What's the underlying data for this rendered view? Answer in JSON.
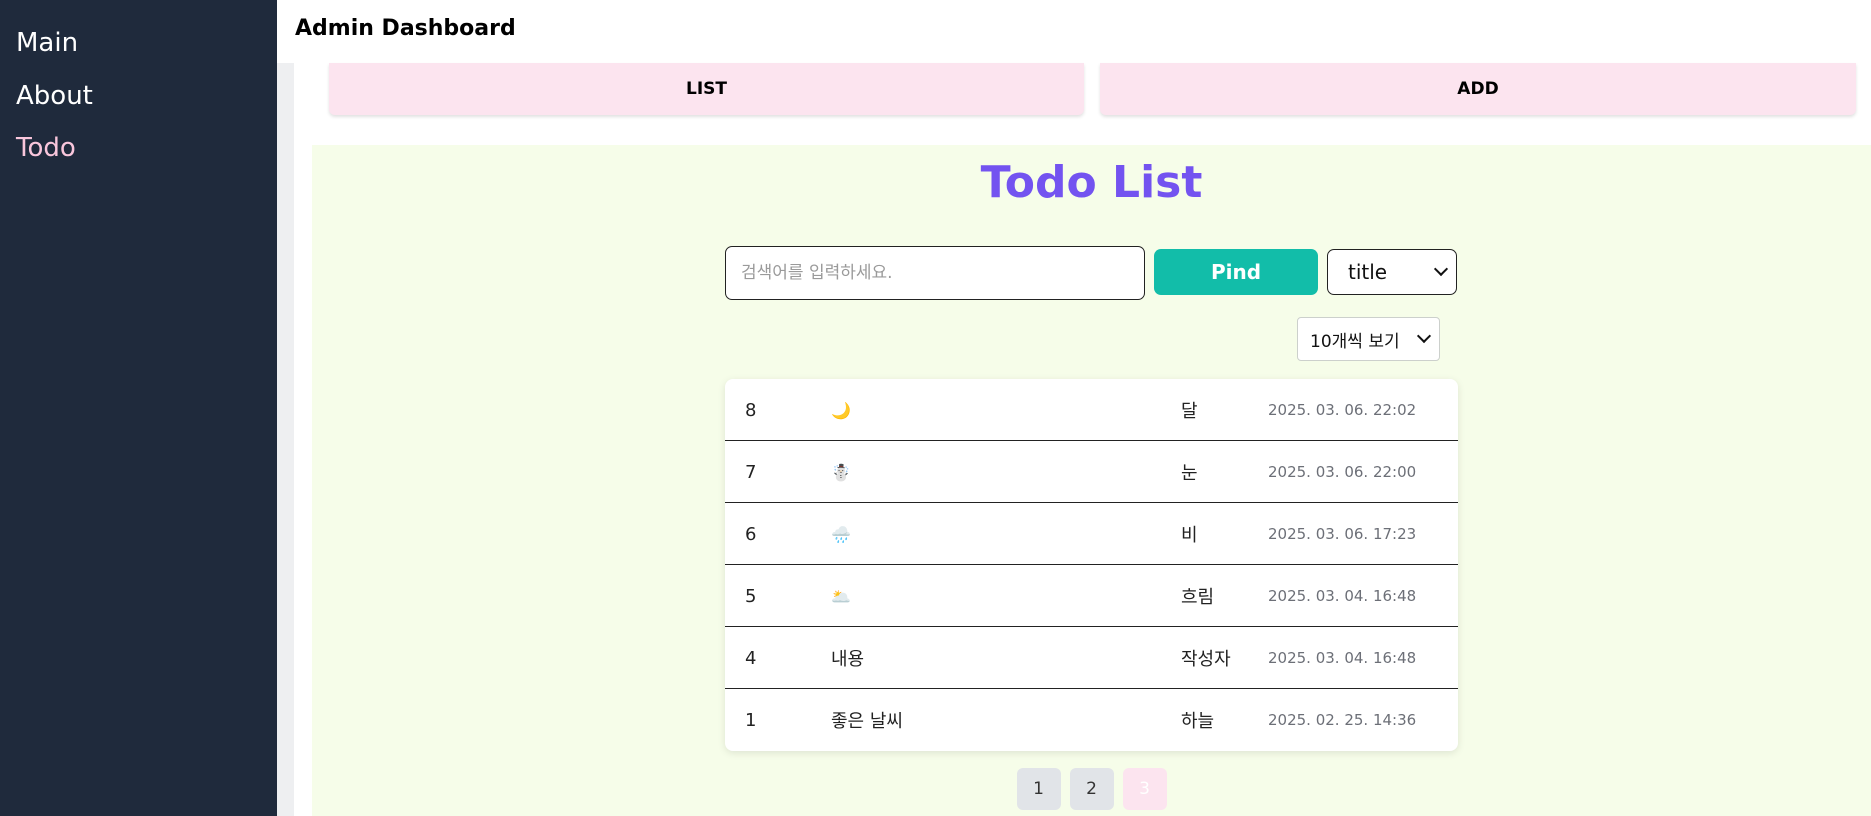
{
  "sidebar": {
    "items": [
      {
        "label": "Main"
      },
      {
        "label": "About"
      },
      {
        "label": "Todo"
      }
    ],
    "active": "Todo"
  },
  "header": {
    "title": "Admin Dashboard"
  },
  "nav": {
    "list_label": "LIST",
    "add_label": "ADD"
  },
  "todo": {
    "title": "Todo List",
    "search": {
      "placeholder": "검색어를 입력하세요.",
      "value": "",
      "button_label": "Pind",
      "type_selected": "title"
    },
    "page_size_selected": "10개씩 보기",
    "rows": [
      {
        "no": "8",
        "title": "🌙",
        "writer": "달",
        "date": "2025. 03. 06. 22:02"
      },
      {
        "no": "7",
        "title": "☃️",
        "writer": "눈",
        "date": "2025. 03. 06. 22:00"
      },
      {
        "no": "6",
        "title": "🌧️",
        "writer": "비",
        "date": "2025. 03. 06. 17:23"
      },
      {
        "no": "5",
        "title": "🌥️",
        "writer": "흐림",
        "date": "2025. 03. 04. 16:48"
      },
      {
        "no": "4",
        "title": "내용",
        "writer": "작성자",
        "date": "2025. 03. 04. 16:48"
      },
      {
        "no": "1",
        "title": "좋은 날씨",
        "writer": "하늘",
        "date": "2025. 02. 25. 14:36"
      }
    ],
    "pages": [
      "1",
      "2",
      "3"
    ],
    "current_page": "3"
  },
  "colors": {
    "sidebar_bg": "#1f2a3c",
    "sidebar_active": "#f9c6dc",
    "nav_button_bg": "#fce4ef",
    "panel_bg": "#f6fde9",
    "title_color": "#7353f0",
    "find_button_bg": "#12bda9",
    "page_active_bg": "#fce4ef"
  },
  "icons": {
    "select_arrow": "chevron-down-icon"
  }
}
